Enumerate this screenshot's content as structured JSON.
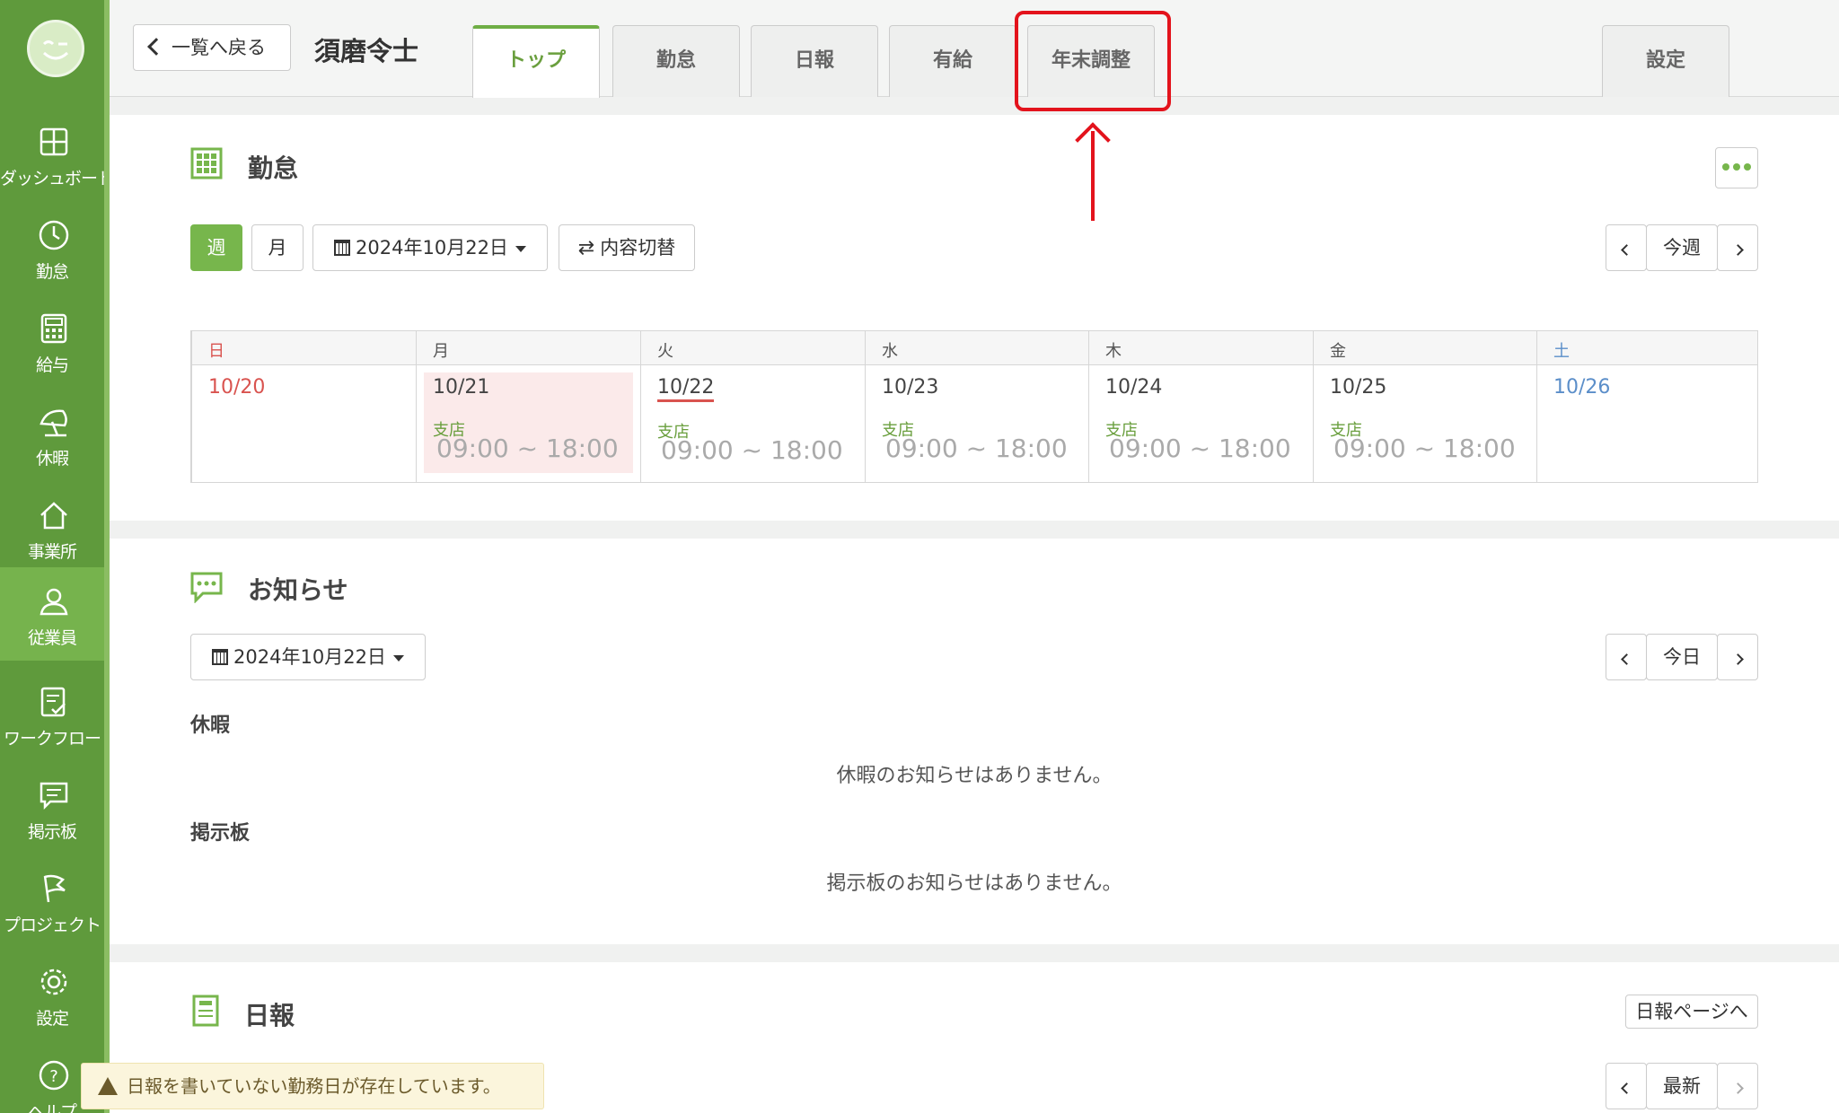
{
  "sidebar": {
    "items": [
      {
        "label": "ダッシュボード",
        "icon": "dashboard-icon"
      },
      {
        "label": "勤怠",
        "icon": "clock-icon"
      },
      {
        "label": "給与",
        "icon": "calculator-icon"
      },
      {
        "label": "休暇",
        "icon": "umbrella-icon"
      },
      {
        "label": "事業所",
        "icon": "home-icon"
      },
      {
        "label": "従業員",
        "icon": "person-icon"
      },
      {
        "label": "ワークフロー",
        "icon": "workflow-icon"
      },
      {
        "label": "掲示板",
        "icon": "chat-icon"
      },
      {
        "label": "プロジェクト",
        "icon": "flag-icon"
      },
      {
        "label": "設定",
        "icon": "gear-icon"
      },
      {
        "label": "ヘルプ",
        "icon": "help-icon"
      }
    ]
  },
  "header": {
    "back_label": "一覧へ戻る",
    "employee_name": "須磨令士",
    "tabs": [
      {
        "label": "トップ"
      },
      {
        "label": "勤怠"
      },
      {
        "label": "日報"
      },
      {
        "label": "有給"
      },
      {
        "label": "年末調整"
      },
      {
        "label": "設定"
      }
    ]
  },
  "attendance": {
    "title": "勤怠",
    "week_label": "週",
    "month_label": "月",
    "date_label": "2024年10月22日",
    "toggle_label": "内容切替",
    "this_week_label": "今週",
    "days": [
      {
        "dow": "日",
        "date": "10/20",
        "branch": "",
        "time": ""
      },
      {
        "dow": "月",
        "date": "10/21",
        "branch": "支店",
        "time": "09:00 ~ 18:00"
      },
      {
        "dow": "火",
        "date": "10/22",
        "branch": "支店",
        "time": "09:00 ~ 18:00"
      },
      {
        "dow": "水",
        "date": "10/23",
        "branch": "支店",
        "time": "09:00 ~ 18:00"
      },
      {
        "dow": "木",
        "date": "10/24",
        "branch": "支店",
        "time": "09:00 ~ 18:00"
      },
      {
        "dow": "金",
        "date": "10/25",
        "branch": "支店",
        "time": "09:00 ~ 18:00"
      },
      {
        "dow": "土",
        "date": "10/26",
        "branch": "",
        "time": ""
      }
    ]
  },
  "notices": {
    "title": "お知らせ",
    "date_label": "2024年10月22日",
    "today_label": "今日",
    "leave_label": "休暇",
    "leave_empty": "休暇のお知らせはありません。",
    "board_label": "掲示板",
    "board_empty": "掲示板のお知らせはありません。"
  },
  "daily_report": {
    "title": "日報",
    "page_link": "日報ページへ",
    "latest_label": "最新",
    "warning": "日報を書いていない勤務日が存在しています。"
  },
  "colors": {
    "sidebar_bg": "#5f9a3c",
    "accent_green": "#77b64c",
    "highlight_red": "#e3131c",
    "sunday_red": "#d9534f",
    "saturday_blue": "#5b8ec9"
  }
}
